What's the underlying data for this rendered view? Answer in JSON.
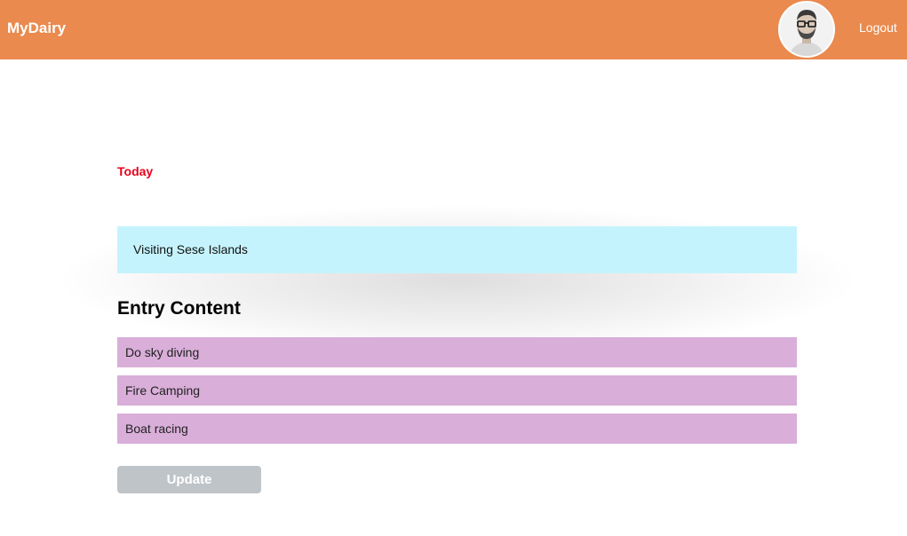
{
  "navbar": {
    "brand": "MyDairy",
    "avatar_icon": "user-avatar-photo",
    "logout_label": "Logout",
    "background_color": "#ea8a4e"
  },
  "entry": {
    "date_label": "Today",
    "title": "Visiting Sese Islands",
    "content_heading": "Entry Content",
    "items": [
      "Do sky diving",
      "Fire Camping",
      "Boat racing"
    ],
    "update_label": "Update"
  },
  "colors": {
    "date_label": "#e8001c",
    "title_background": "#c5f3fd",
    "item_background": "#d9aed9",
    "button_background": "#bfc4c8"
  }
}
